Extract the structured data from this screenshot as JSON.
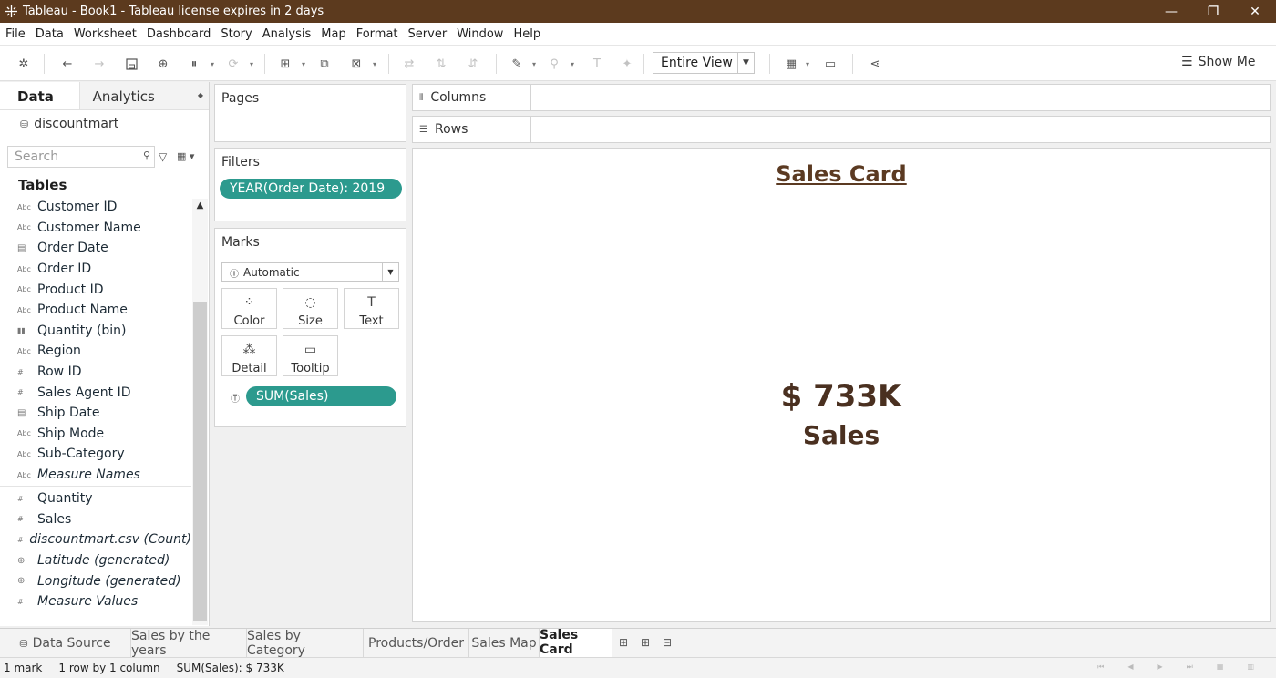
{
  "window": {
    "title": "Tableau - Book1 - Tableau license expires in 2 days",
    "controls": {
      "minimize": "—",
      "restore": "❐",
      "close": "✕"
    }
  },
  "menu": [
    "File",
    "Data",
    "Worksheet",
    "Dashboard",
    "Story",
    "Analysis",
    "Map",
    "Format",
    "Server",
    "Window",
    "Help"
  ],
  "toolbar": {
    "view_mode": "Entire View",
    "show_me": "Show Me"
  },
  "data_pane": {
    "tabs": {
      "data": "Data",
      "analytics": "Analytics"
    },
    "data_source": "discountmart",
    "search_placeholder": "Search",
    "tables_heading": "Tables",
    "dimensions": [
      {
        "icon": "Abc",
        "name": "Customer ID",
        "italic": false
      },
      {
        "icon": "Abc",
        "name": "Customer Name",
        "italic": false
      },
      {
        "icon": "calendar",
        "name": "Order Date",
        "italic": false
      },
      {
        "icon": "Abc",
        "name": "Order ID",
        "italic": false
      },
      {
        "icon": "Abc",
        "name": "Product ID",
        "italic": false
      },
      {
        "icon": "Abc",
        "name": "Product Name",
        "italic": false
      },
      {
        "icon": "bin",
        "name": "Quantity (bin)",
        "italic": false
      },
      {
        "icon": "Abc",
        "name": "Region",
        "italic": false
      },
      {
        "icon": "#",
        "name": "Row ID",
        "italic": false
      },
      {
        "icon": "#",
        "name": "Sales Agent ID",
        "italic": false
      },
      {
        "icon": "calendar",
        "name": "Ship Date",
        "italic": false
      },
      {
        "icon": "Abc",
        "name": "Ship Mode",
        "italic": false
      },
      {
        "icon": "Abc",
        "name": "Sub-Category",
        "italic": false
      },
      {
        "icon": "Abc",
        "name": "Measure Names",
        "italic": true
      }
    ],
    "measures": [
      {
        "icon": "#",
        "name": "Quantity",
        "italic": false
      },
      {
        "icon": "#",
        "name": "Sales",
        "italic": false
      },
      {
        "icon": "#",
        "name": "discountmart.csv (Count)",
        "italic": true
      },
      {
        "icon": "globe",
        "name": "Latitude (generated)",
        "italic": true
      },
      {
        "icon": "globe",
        "name": "Longitude (generated)",
        "italic": true
      },
      {
        "icon": "#",
        "name": "Measure Values",
        "italic": true
      }
    ]
  },
  "cards": {
    "pages": "Pages",
    "filters": {
      "title": "Filters",
      "pill": "YEAR(Order Date): 2019"
    },
    "marks": {
      "title": "Marks",
      "mark_type": "Automatic",
      "buttons": [
        "Color",
        "Size",
        "Text",
        "Detail",
        "Tooltip"
      ],
      "pill": "SUM(Sales)"
    }
  },
  "shelves": {
    "columns": "Columns",
    "rows": "Rows"
  },
  "viz": {
    "title": "Sales Card",
    "value": "$ 733K",
    "label": "Sales",
    "title_color": "#5b3a22"
  },
  "sheet_tabs": {
    "data_source": "Data Source",
    "sheets": [
      "Sales by the years",
      "Sales by Category",
      "Products/Order",
      "Sales Map",
      "Sales Card"
    ],
    "active": "Sales Card"
  },
  "status": {
    "marks": "1 mark",
    "dims": "1 row by 1 column",
    "summary": "SUM(Sales): $ 733K"
  },
  "colors": {
    "titlebar": "#5c3a1e",
    "pill": "#2c9a8e"
  }
}
